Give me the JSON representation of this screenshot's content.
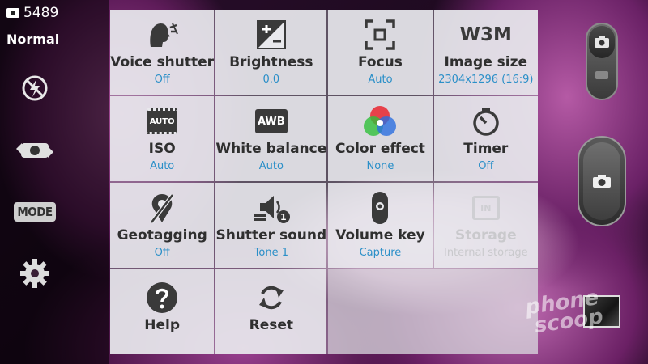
{
  "status": {
    "shot_count": "5489",
    "mode": "Normal"
  },
  "left_controls": {
    "mode_badge": "MODE"
  },
  "settings": [
    {
      "label": "Voice shutter",
      "value": "Off",
      "icon": "voice-shutter-icon"
    },
    {
      "label": "Brightness",
      "value": "0.0",
      "icon": "brightness-icon"
    },
    {
      "label": "Focus",
      "value": "Auto",
      "icon": "focus-icon"
    },
    {
      "label": "Image size",
      "value": "2304x1296 (16:9)",
      "icon": "image-size-icon",
      "icon_text": "W3M"
    },
    {
      "label": "ISO",
      "value": "Auto",
      "icon": "iso-icon",
      "icon_text": "AUTO"
    },
    {
      "label": "White balance",
      "value": "Auto",
      "icon": "white-balance-icon",
      "icon_text": "AWB"
    },
    {
      "label": "Color effect",
      "value": "None",
      "icon": "color-effect-icon"
    },
    {
      "label": "Timer",
      "value": "Off",
      "icon": "timer-icon"
    },
    {
      "label": "Geotagging",
      "value": "Off",
      "icon": "geotag-icon"
    },
    {
      "label": "Shutter sound",
      "value": "Tone 1",
      "icon": "shutter-sound-icon",
      "icon_text": "1"
    },
    {
      "label": "Volume key",
      "value": "Capture",
      "icon": "volume-key-icon"
    },
    {
      "label": "Storage",
      "value": "Internal storage",
      "icon": "storage-icon",
      "icon_text": "IN",
      "disabled": true
    },
    {
      "label": "Help",
      "value": "",
      "icon": "help-icon"
    },
    {
      "label": "Reset",
      "value": "",
      "icon": "reset-icon"
    }
  ],
  "watermark": {
    "line1": "phone",
    "line2": "scoop"
  },
  "colors": {
    "value_blue": "#2a8fc8",
    "label_dark": "#2f2f2f"
  }
}
